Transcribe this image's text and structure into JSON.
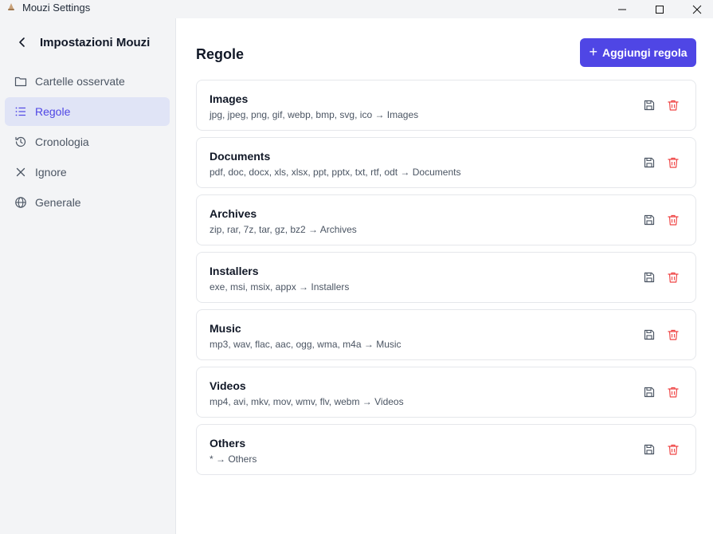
{
  "window": {
    "title": "Mouzi Settings"
  },
  "sidebar": {
    "title": "Impostazioni Mouzi",
    "items": [
      {
        "label": "Cartelle osservate",
        "icon": "folder-icon",
        "active": false
      },
      {
        "label": "Regole",
        "icon": "list-icon",
        "active": true
      },
      {
        "label": "Cronologia",
        "icon": "history-icon",
        "active": false
      },
      {
        "label": "Ignore",
        "icon": "x-icon",
        "active": false
      },
      {
        "label": "Generale",
        "icon": "globe-icon",
        "active": false
      }
    ]
  },
  "main": {
    "title": "Regole",
    "add_button_label": "Aggiungi regola",
    "rules": [
      {
        "name": "Images",
        "description": "jpg, jpeg, png, gif, webp, bmp, svg, ico → Images"
      },
      {
        "name": "Documents",
        "description": "pdf, doc, docx, xls, xlsx, ppt, pptx, txt, rtf, odt → Documents"
      },
      {
        "name": "Archives",
        "description": "zip, rar, 7z, tar, gz, bz2 → Archives"
      },
      {
        "name": "Installers",
        "description": "exe, msi, msix, appx → Installers"
      },
      {
        "name": "Music",
        "description": "mp3, wav, flac, aac, ogg, wma, m4a → Music"
      },
      {
        "name": "Videos",
        "description": "mp4, avi, mkv, mov, wmv, flv, webm → Videos"
      },
      {
        "name": "Others",
        "description": "* → Others"
      }
    ]
  },
  "colors": {
    "accent": "#4f46e5",
    "active_nav_bg": "#e0e4f6",
    "delete": "#ef4444",
    "sidebar_bg": "#f3f4f6"
  }
}
